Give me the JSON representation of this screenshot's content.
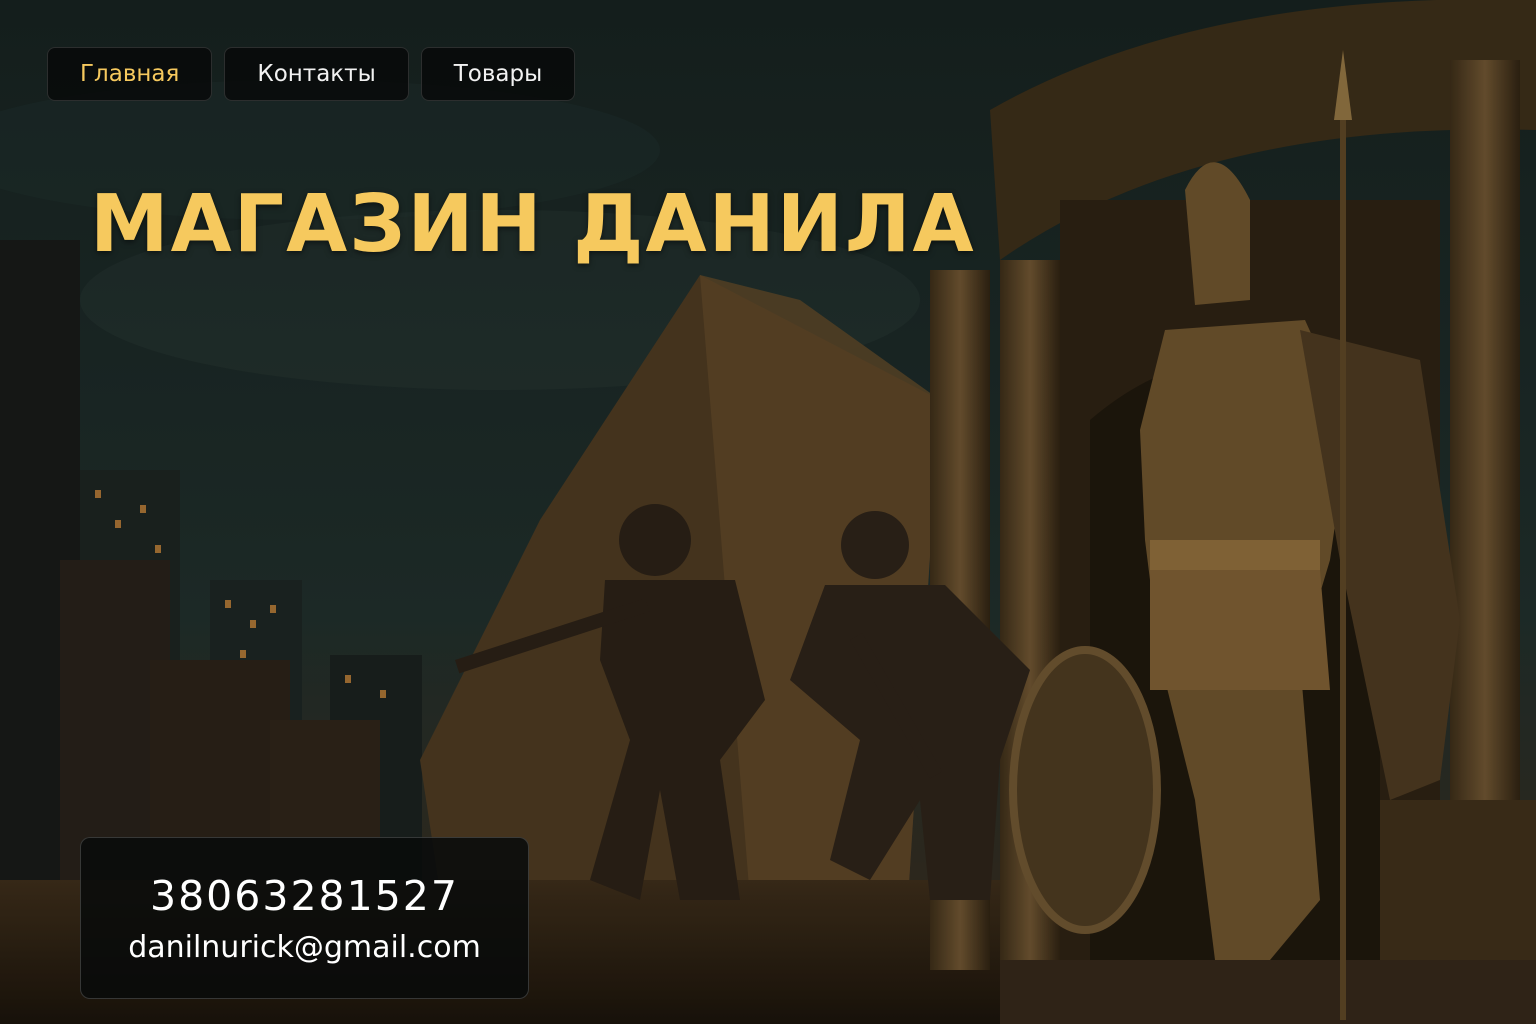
{
  "nav": {
    "items": [
      {
        "label": "Главная",
        "active": true
      },
      {
        "label": "Контакты",
        "active": false
      },
      {
        "label": "Товары",
        "active": false
      }
    ]
  },
  "hero": {
    "title": "МАГАЗИН ДАНИЛА"
  },
  "contact": {
    "phone": "38063281527",
    "email": "danilnurick@gmail.com"
  },
  "colors": {
    "accent": "#f6c95e",
    "nav_bg": "#080a0a",
    "text": "#ffffff",
    "stone": "#5a4424"
  },
  "background": {
    "icons": [
      "night-sky",
      "city-buildings",
      "pyramid",
      "soldier-figure",
      "soldier-figure",
      "spartan-statue",
      "temple-columns",
      "round-shield",
      "spear"
    ]
  }
}
